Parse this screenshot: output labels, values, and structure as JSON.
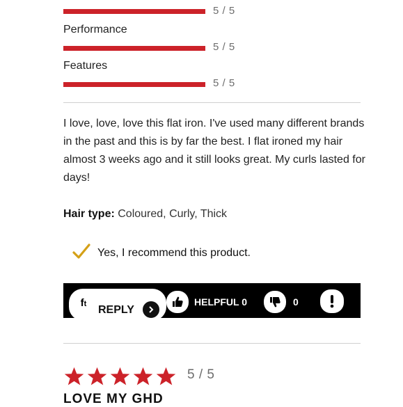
{
  "ratings": [
    {
      "label": "",
      "value": "5 / 5"
    },
    {
      "label": "Performance",
      "value": "5 / 5"
    },
    {
      "label": "Features",
      "value": "5 / 5"
    }
  ],
  "review": {
    "text": "I love, love, love this flat iron. I've used many different brands in the past and this is by far the best. I flat ironed my hair almost 3 weeks ago and it still looks great. My curls lasted for days!",
    "hair_type_label": "Hair type:",
    "hair_type_value": "Coloured, Curly, Thick",
    "recommend_text": "Yes, I recommend this product."
  },
  "actions": {
    "fb_label": "f",
    "reply_label": "REPLY",
    "helpful_label": "HELPFUL 0",
    "not_helpful_count": "0"
  },
  "next_review": {
    "rating": "5 / 5",
    "stars": 5,
    "title": "LOVE MY GHD"
  },
  "colors": {
    "bar": "#cc2229",
    "star": "#cc2229",
    "check": "#d4a017",
    "action_bar_bg": "#000000"
  },
  "icons": {
    "recommend": "check-icon",
    "helpful": "thumbs-up-icon",
    "not_helpful": "thumbs-down-icon",
    "report": "exclamation-icon",
    "reply_arrow": "chevron-right-icon",
    "share": "facebook-icon"
  }
}
